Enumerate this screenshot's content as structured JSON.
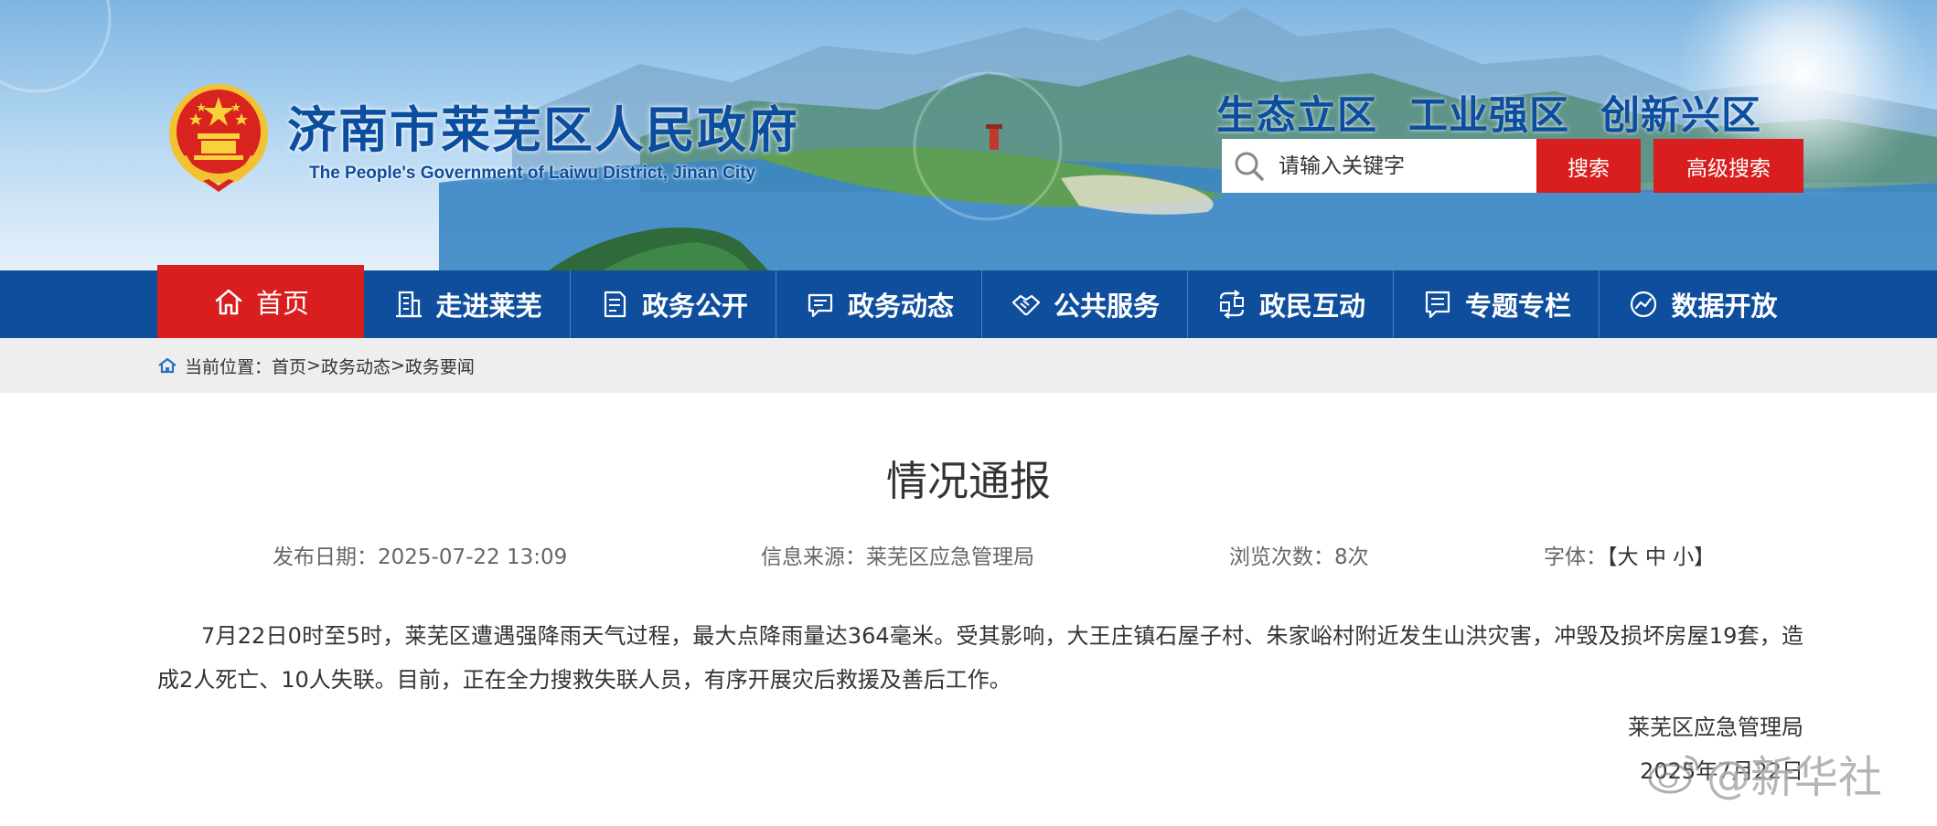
{
  "header": {
    "title": "济南市莱芜区人民政府",
    "subtitle": "The People's Government of Laiwu District, Jinan City",
    "slogan": "生态立区 工业强区 创新兴区",
    "search": {
      "placeholder": "请输入关键字",
      "button_label": "搜索",
      "advanced_label": "高级搜索"
    }
  },
  "nav": {
    "items": [
      {
        "label": "首页",
        "icon": "home-icon",
        "active": true
      },
      {
        "label": "走进莱芜",
        "icon": "building-icon"
      },
      {
        "label": "政务公开",
        "icon": "document-icon"
      },
      {
        "label": "政务动态",
        "icon": "chat-icon"
      },
      {
        "label": "公共服务",
        "icon": "handshake-icon"
      },
      {
        "label": "政民互动",
        "icon": "interaction-icon"
      },
      {
        "label": "专题专栏",
        "icon": "column-icon"
      },
      {
        "label": "数据开放",
        "icon": "data-icon"
      }
    ]
  },
  "breadcrumb": {
    "prefix": "当前位置：",
    "items": [
      "首页",
      "政务动态",
      "政务要闻"
    ],
    "separator": ">"
  },
  "article": {
    "title": "情况通报",
    "meta": {
      "date": "发布日期：2025-07-22 13:09",
      "source": "信息来源：莱芜区应急管理局",
      "views": "浏览次数：8次",
      "font_label": "字体：",
      "font_open": "【",
      "font_large": "大",
      "font_medium": "中",
      "font_small": "小",
      "font_close": "】"
    },
    "body": "7月22日0时至5时，莱芜区遭遇强降雨天气过程，最大点降雨量达364毫米。受其影响，大王庄镇石屋子村、朱家峪村附近发生山洪灾害，冲毁及损坏房屋19套，造成2人死亡、10人失联。目前，正在全力搜救失联人员，有序开展灾后救援及善后工作。",
    "signature": "莱芜区应急管理局",
    "signature_date": "2025年7月22日"
  },
  "watermark": {
    "text": "@新华社"
  },
  "colors": {
    "brand_blue": "#0f4e9c",
    "accent_red": "#d81e1e",
    "title_blue": "#0b4d9e"
  }
}
